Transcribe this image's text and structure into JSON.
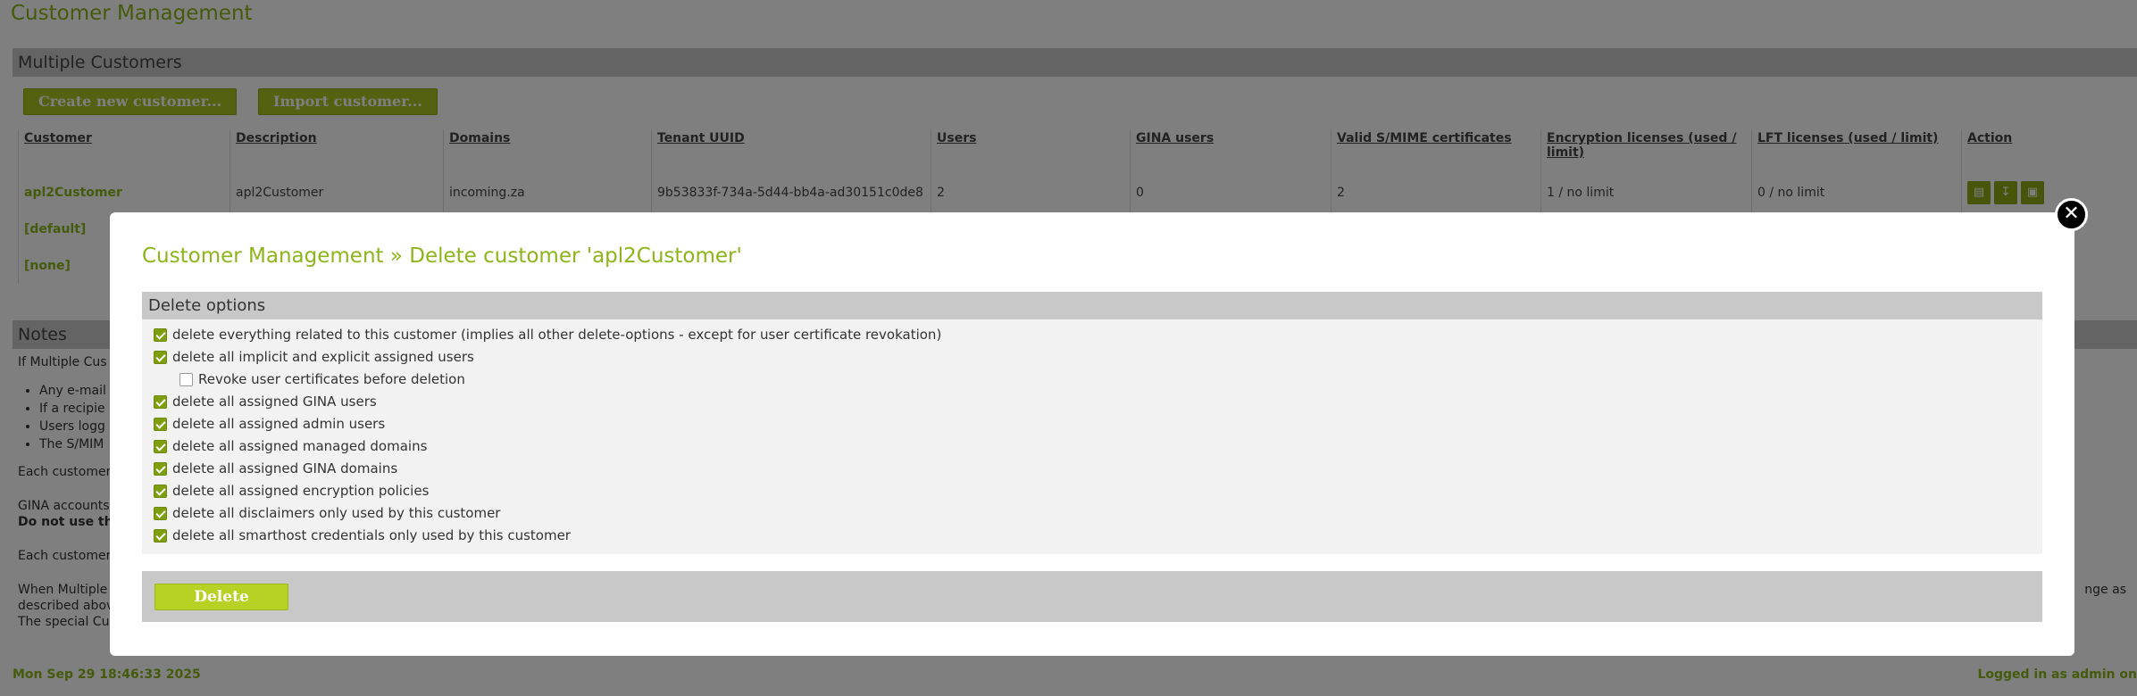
{
  "page": {
    "title": "Customer Management"
  },
  "multiple_customers": {
    "header": "Multiple Customers",
    "create_label": "Create new customer...",
    "import_label": "Import customer...",
    "columns": [
      "Customer",
      "Description",
      "Domains",
      "Tenant UUID",
      "Users",
      "GINA users",
      "Valid S/MIME certificates",
      "Encryption licenses (used / limit)",
      "LFT licenses (used / limit)",
      "Action"
    ],
    "rows": [
      {
        "customer": "apl2Customer",
        "description": "apl2Customer",
        "domains": "incoming.za",
        "tenant_uuid": "9b53833f-734a-5d44-bb4a-ad30151c0de8",
        "users": "2",
        "gina_users": "0",
        "smime": "2",
        "enc_licenses": "1 / no limit",
        "lft_licenses": "0 / no limit"
      },
      {
        "customer": "[default]"
      },
      {
        "customer": "[none]"
      }
    ],
    "action_icons": [
      "document-icon",
      "download-icon",
      "trash-icon"
    ]
  },
  "notes": {
    "header": "Notes",
    "intro": "If Multiple Cus",
    "bullets": [
      "Any e-mail",
      "If a recipie",
      "Users logg",
      "The S/MIM"
    ],
    "line1": "Each customer",
    "line2": "GINA accounts",
    "line3_bold": "Do not use th",
    "line4": "Each customer",
    "line5": "When Multiple",
    "line5_tail": "nge as",
    "line6": "described abov",
    "line7": "The special Cu"
  },
  "footer": {
    "timestamp": "Mon Sep 29 18:46:33 2025",
    "logged_in": "Logged in as admin on"
  },
  "modal": {
    "title_section": "Customer Management",
    "title_separator": "»",
    "title_action": "Delete customer 'apl2Customer'",
    "delete_options_header": "Delete options",
    "options": [
      {
        "label": "delete everything related to this customer (implies all other delete-options - except for user certificate revokation)",
        "checked": true
      },
      {
        "label": "delete all implicit and explicit assigned users",
        "checked": true
      },
      {
        "label": "Revoke user certificates before deletion",
        "checked": false
      },
      {
        "label": "delete all assigned GINA users",
        "checked": true
      },
      {
        "label": "delete all assigned admin users",
        "checked": true
      },
      {
        "label": "delete all assigned managed domains",
        "checked": true
      },
      {
        "label": "delete all assigned GINA domains",
        "checked": true
      },
      {
        "label": "delete all assigned encryption policies",
        "checked": true
      },
      {
        "label": "delete all disclaimers only used by this customer",
        "checked": true
      },
      {
        "label": "delete all smarthost credentials only used by this customer",
        "checked": true
      }
    ],
    "delete_label": "Delete",
    "close_glyph": "✕"
  },
  "colors": {
    "accent": "#8bb518",
    "button": "#a6c320",
    "checkbox": "#7f9e0e",
    "overlay": "rgba(0,0,0,0.5)"
  }
}
